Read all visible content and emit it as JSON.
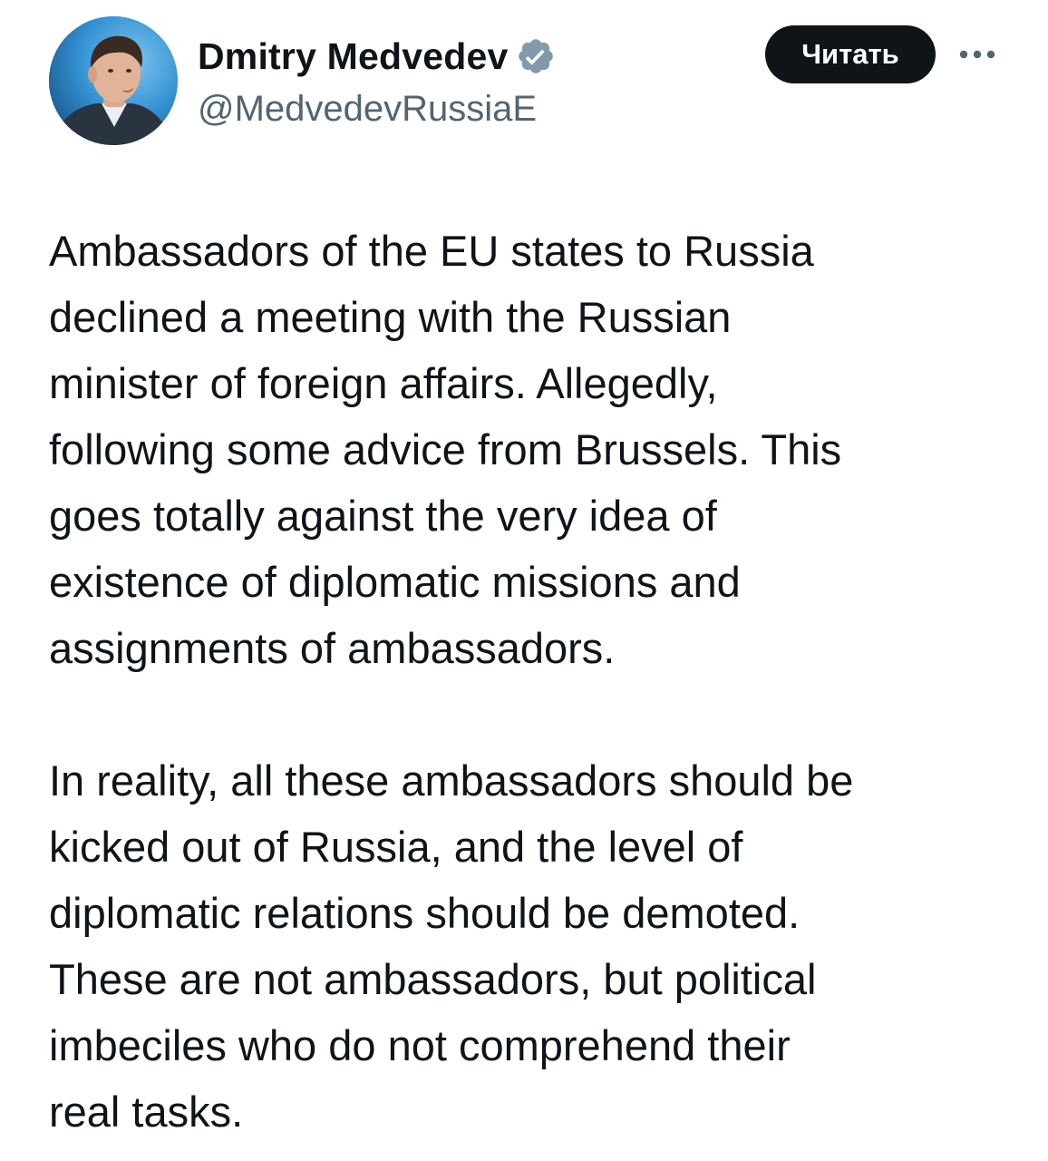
{
  "author": {
    "display_name": "Dmitry Medvedev",
    "handle": "@MedvedevRussiaE",
    "verified": true,
    "avatar_icon": "profile-photo"
  },
  "actions": {
    "follow_label": "Читать",
    "more_icon": "more-dots-icon"
  },
  "tweet": {
    "paragraphs": [
      "Ambassadors of the EU states to Russia\ndeclined a meeting with the Russian\nminister of foreign affairs. Allegedly,\nfollowing some advice from Brussels. This\ngoes totally against the very idea of\nexistence of diplomatic missions and\nassignments of ambassadors.",
      "In reality, all these ambassadors should be\nkicked out of Russia, and the level of\ndiplomatic relations should be demoted.\nThese are not ambassadors, but political\nimbeciles who do not comprehend their\nreal tasks."
    ]
  },
  "colors": {
    "text": "#0f1419",
    "secondary_text": "#536471",
    "verified_badge": "#829aab",
    "button_bg": "#0f1419",
    "button_text": "#ffffff"
  }
}
